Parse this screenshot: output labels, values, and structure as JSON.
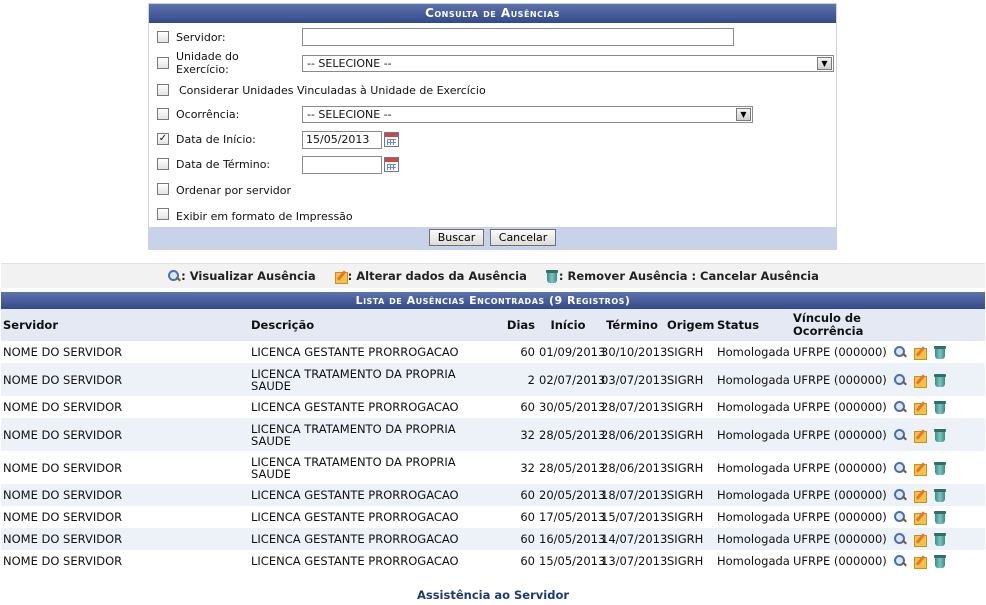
{
  "form": {
    "title": "Consulta de Ausências",
    "servidor": {
      "label": "Servidor:",
      "value": "",
      "checked": false
    },
    "unidade": {
      "label_line1": "Unidade do",
      "label_line2": "Exercício:",
      "selected": "-- SELECIONE --",
      "checked": false
    },
    "vinculadas": {
      "label": "Considerar Unidades Vinculadas à Unidade de Exercício",
      "checked": false
    },
    "ocorrencia": {
      "label": "Ocorrência:",
      "selected": "-- SELECIONE --",
      "checked": false
    },
    "data_inicio": {
      "label": "Data de Início:",
      "value": "15/05/2013",
      "checked": true,
      "check_mark": "✓"
    },
    "data_termino": {
      "label": "Data de Término:",
      "value": "",
      "checked": false
    },
    "ordenar": {
      "label": "Ordenar por servidor",
      "checked": false
    },
    "impressao": {
      "label": "Exibir em formato de Impressão",
      "checked": false
    },
    "buttons": {
      "buscar": "Buscar",
      "cancelar": "Cancelar"
    },
    "dropdown_arrow": "▼"
  },
  "legend": {
    "visualizar": ": Visualizar Ausência",
    "alterar": ": Alterar dados da Ausência",
    "remover": ": Remover Ausência : Cancelar Ausência",
    "icons": [
      "magnifier-icon",
      "edit-icon",
      "trash-icon"
    ]
  },
  "results": {
    "title": "Lista de Ausências Encontradas (9 Registros)",
    "columns": {
      "servidor": "Servidor",
      "descricao": "Descrição",
      "dias": "Dias",
      "inicio": "Início",
      "termino": "Término",
      "origem": "Origem",
      "status": "Status",
      "vinculo": "Vínculo de Ocorrência"
    },
    "rows": [
      {
        "servidor": "NOME DO SERVIDOR",
        "descricao": "LICENCA GESTANTE PRORROGACAO",
        "dias": "60",
        "inicio": "01/09/2013",
        "termino": "30/10/2013",
        "origem": "SIGRH",
        "status": "Homologada",
        "vinculo": "UFRPE (000000)"
      },
      {
        "servidor": "NOME DO SERVIDOR",
        "descricao": "LICENCA TRATAMENTO DA PROPRIA SAUDE",
        "dias": "2",
        "inicio": "02/07/2013",
        "termino": "03/07/2013",
        "origem": "SIGRH",
        "status": "Homologada",
        "vinculo": "UFRPE (000000)"
      },
      {
        "servidor": "NOME DO SERVIDOR",
        "descricao": "LICENCA GESTANTE PRORROGACAO",
        "dias": "60",
        "inicio": "30/05/2013",
        "termino": "28/07/2013",
        "origem": "SIGRH",
        "status": "Homologada",
        "vinculo": "UFRPE (000000)"
      },
      {
        "servidor": "NOME DO SERVIDOR",
        "descricao": "LICENCA TRATAMENTO DA PROPRIA SAUDE",
        "dias": "32",
        "inicio": "28/05/2013",
        "termino": "28/06/2013",
        "origem": "SIGRH",
        "status": "Homologada",
        "vinculo": "UFRPE (000000)"
      },
      {
        "servidor": "NOME DO SERVIDOR",
        "descricao": "LICENCA TRATAMENTO DA PROPRIA SAUDE",
        "dias": "32",
        "inicio": "28/05/2013",
        "termino": "28/06/2013",
        "origem": "SIGRH",
        "status": "Homologada",
        "vinculo": "UFRPE (000000)"
      },
      {
        "servidor": "NOME DO SERVIDOR",
        "descricao": "LICENCA GESTANTE PRORROGACAO",
        "dias": "60",
        "inicio": "20/05/2013",
        "termino": "18/07/2013",
        "origem": "SIGRH",
        "status": "Homologada",
        "vinculo": "UFRPE (000000)"
      },
      {
        "servidor": "NOME DO SERVIDOR",
        "descricao": "LICENCA GESTANTE PRORROGACAO",
        "dias": "60",
        "inicio": "17/05/2013",
        "termino": "15/07/2013",
        "origem": "SIGRH",
        "status": "Homologada",
        "vinculo": "UFRPE (000000)"
      },
      {
        "servidor": "NOME DO SERVIDOR",
        "descricao": "LICENCA GESTANTE PRORROGACAO",
        "dias": "60",
        "inicio": "16/05/2013",
        "termino": "14/07/2013",
        "origem": "SIGRH",
        "status": "Homologada",
        "vinculo": "UFRPE (000000)"
      },
      {
        "servidor": "NOME DO SERVIDOR",
        "descricao": "LICENCA GESTANTE PRORROGACAO",
        "dias": "60",
        "inicio": "15/05/2013",
        "termino": "13/07/2013",
        "origem": "SIGRH",
        "status": "Homologada",
        "vinculo": "UFRPE (000000)"
      }
    ]
  },
  "footer": {
    "link": "Assistência ao Servidor"
  },
  "colors": {
    "header_blue": "#3e5590",
    "footer_bar": "#c8d3ea",
    "row_alt": "#edf1f8",
    "link": "#1c3a7a"
  }
}
